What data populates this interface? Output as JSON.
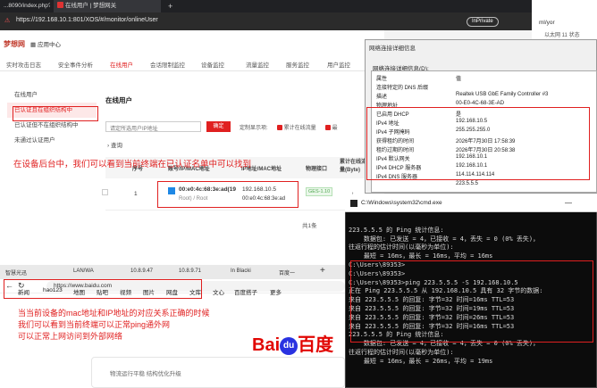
{
  "browser": {
    "tabs": [
      "...8090/index.php?id=...",
      "在线用户 | 梦想网关"
    ],
    "url": "https://192.168.10.1:801/XOS/#/monitor/onlineUser",
    "inprivate": "InPrivate",
    "right_text1": "ml/yor",
    "right_text2": "以太网 11 状态"
  },
  "app": {
    "logo": "梦想网",
    "app_center": "应用中心",
    "nav": [
      "实时攻击日志",
      "安全事件分析",
      "在线用户",
      "会话限制监控",
      "设备监控",
      "流量监控",
      "服务监控",
      "用户监控"
    ],
    "sidebar": [
      "在线用户",
      "已认证且在组织结构中",
      "已认证但不在组织结构中",
      "未通过认证用户"
    ],
    "panel_title": "在线用户",
    "filter_placeholder": "请定所选用户IP地址",
    "confirm": "确定",
    "customize": "定制显示项:",
    "chk1": "累计在线流量",
    "chk2": "最",
    "query": "查询",
    "table_headers": [
      "序号",
      "账号/IP/MAC地址",
      "IP地址/MAC地址",
      "物理接口",
      "累计在线流量(Byte)"
    ],
    "row": {
      "index": "1",
      "account": "00:e0:4c:68:3e:ad(19",
      "role": "Root) / Root",
      "ip": "192.168.10.5",
      "mac": "00:e0:4c:68:3e:ad",
      "iface": "GES-1.10",
      "traffic": "↑"
    },
    "count": "共1条",
    "annotation": "在设备后台中，我们可以看到当前终端在已认证名单中可以找到"
  },
  "props": {
    "title": "网络连接详细信息",
    "label": "网络连接详细信息(D):",
    "rows": [
      [
        "属性",
        "值"
      ],
      [
        "连接特定的 DNS 后缀",
        ""
      ],
      [
        "描述",
        "Realtek USB GbE Family Controller #3"
      ],
      [
        "物理地址",
        "00-E0-4C-68-3E-AD"
      ],
      [
        "已启用 DHCP",
        "是"
      ],
      [
        "IPv4 地址",
        "192.168.10.5"
      ],
      [
        "IPv4 子网掩码",
        "255.255.255.0"
      ],
      [
        "获得租约的时间",
        "2026年7月30日 17:58:39"
      ],
      [
        "租约过期的时间",
        "2026年7月30日 20:58:38"
      ],
      [
        "IPv4 默认网关",
        "192.168.10.1"
      ],
      [
        "IPv4 DHCP 服务器",
        "192.168.10.1"
      ],
      [
        "IPv4 DNS 服务器",
        "114.114.114.114"
      ],
      [
        "",
        "223.5.5.5"
      ]
    ]
  },
  "cmd": {
    "title": "C:\\Windows\\system32\\cmd.exe",
    "lines": [
      "223.5.5.5 的 Ping 统计信息:",
      "    数据包: 已发送 = 4，已接收 = 4，丢失 = 0 (0% 丢失)，",
      "往返行程的估计时间(以毫秒为单位):",
      "    最短 = 16ms，最长 = 16ms，平均 = 16ms",
      "",
      "C:\\Users\\89353>",
      "C:\\Users\\89353>",
      "C:\\Users\\89353>ping 223.5.5.5 -S 192.168.10.5",
      "",
      "正在 Ping 223.5.5.5 从 192.168.10.5 具有 32 字节的数据:",
      "来自 223.5.5.5 的回复: 字节=32 时间=16ms TTL=53",
      "来自 223.5.5.5 的回复: 字节=32 时间=19ms TTL=53",
      "来自 223.5.5.5 的回复: 字节=32 时间=26ms TTL=53",
      "来自 223.5.5.5 的回复: 字节=32 时间=16ms TTL=53",
      "",
      "223.5.5.5 的 Ping 统计信息:",
      "    数据包: 已发送 = 4，已接收 = 4，丢失 = 0 (0% 丢失)，",
      "往返行程的估计时间(以毫秒为单位):",
      "    最短 = 16ms，最长 = 26ms，平均 = 19ms"
    ]
  },
  "browser2": {
    "tabs": [
      "智慧光迅",
      "LAN/WA",
      "10.8.9.47",
      "10.8.9.71",
      "In Blacki",
      "百度一"
    ],
    "url": "https://www.baidu.com",
    "nav": [
      "新闻",
      "hao123",
      "地图",
      "贴吧",
      "视频",
      "图片",
      "网盘",
      "文库",
      "文心",
      "百度搭子",
      "更多"
    ],
    "annotation": "当当前设备的mac地址和IP地址的对应关系正确的时候\n我们可以看到当前终端可以正常ping通外网\n可以正常上网访问到外部网络",
    "logo_left": "Bai",
    "logo_du": "du",
    "logo_right": "百度",
    "card_text": "物流运行平稳 结构优化升级"
  }
}
